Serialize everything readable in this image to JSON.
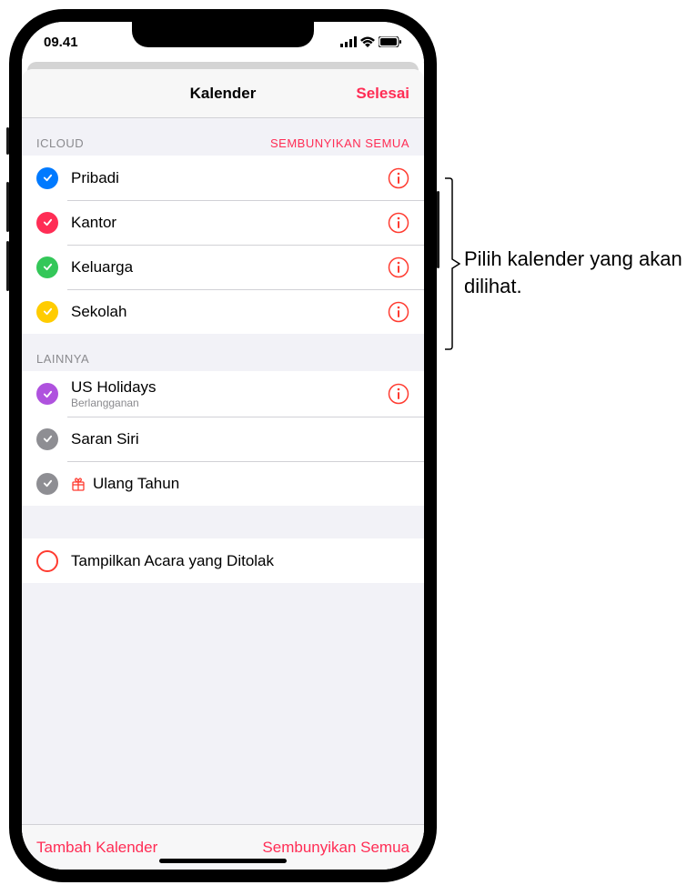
{
  "status": {
    "time": "09.41"
  },
  "header": {
    "title": "Kalender",
    "done": "Selesai"
  },
  "sections": {
    "icloud": {
      "title": "ICLOUD",
      "action": "SEMBUNYIKAN SEMUA",
      "items": [
        {
          "label": "Pribadi",
          "color": "#007aff"
        },
        {
          "label": "Kantor",
          "color": "#ff2d55"
        },
        {
          "label": "Keluarga",
          "color": "#34c759"
        },
        {
          "label": "Sekolah",
          "color": "#ffcc00"
        }
      ]
    },
    "others": {
      "title": "LAINNYA",
      "items": [
        {
          "label": "US Holidays",
          "sublabel": "Berlangganan",
          "color": "#af52de",
          "hasInfo": true
        },
        {
          "label": "Saran Siri",
          "color": "#8e8e93",
          "hasInfo": false
        },
        {
          "label": "Ulang Tahun",
          "color": "#8e8e93",
          "hasInfo": false,
          "birthdayIcon": true
        }
      ]
    },
    "declined": {
      "label": "Tampilkan Acara yang Ditolak"
    }
  },
  "toolbar": {
    "add": "Tambah Kalender",
    "hideAll": "Sembunyikan Semua"
  },
  "callout": {
    "text": "Pilih kalender yang akan dilihat."
  }
}
